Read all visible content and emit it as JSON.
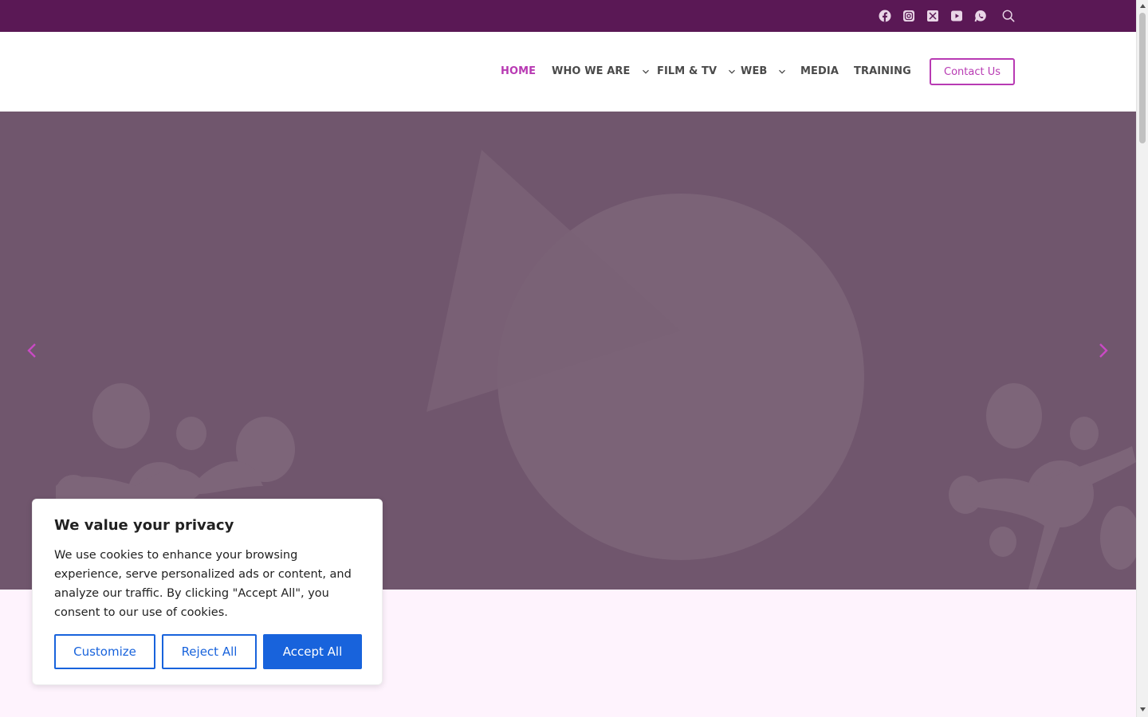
{
  "topbar": {
    "bg": "#5a1855",
    "social_icons": [
      "facebook-icon",
      "instagram-icon",
      "x-twitter-icon",
      "youtube-icon",
      "whatsapp-icon",
      "search-icon"
    ]
  },
  "nav": {
    "items": [
      {
        "label": "HOME",
        "active": true,
        "dropdown": false
      },
      {
        "label": "WHO WE ARE",
        "active": false,
        "dropdown": true
      },
      {
        "label": "FILM & TV",
        "active": false,
        "dropdown": true
      },
      {
        "label": "WEB",
        "active": false,
        "dropdown": true
      },
      {
        "label": "MEDIA",
        "active": false,
        "dropdown": false
      },
      {
        "label": "TRAINING",
        "active": false,
        "dropdown": false
      }
    ],
    "contact_label": "Contact Us",
    "accent": "#b83ab3"
  },
  "hero": {
    "bg": "#70566d",
    "prev_icon": "chevron-left-icon",
    "next_icon": "chevron-right-icon"
  },
  "cookie": {
    "title": "We value your privacy",
    "body": "We use cookies to enhance your browsing experience, serve personalized ads or content, and analyze our traffic. By clicking \"Accept All\", you consent to our use of cookies.",
    "customize_label": "Customize",
    "reject_label": "Reject All",
    "accept_label": "Accept All",
    "accent": "#1863dc"
  }
}
